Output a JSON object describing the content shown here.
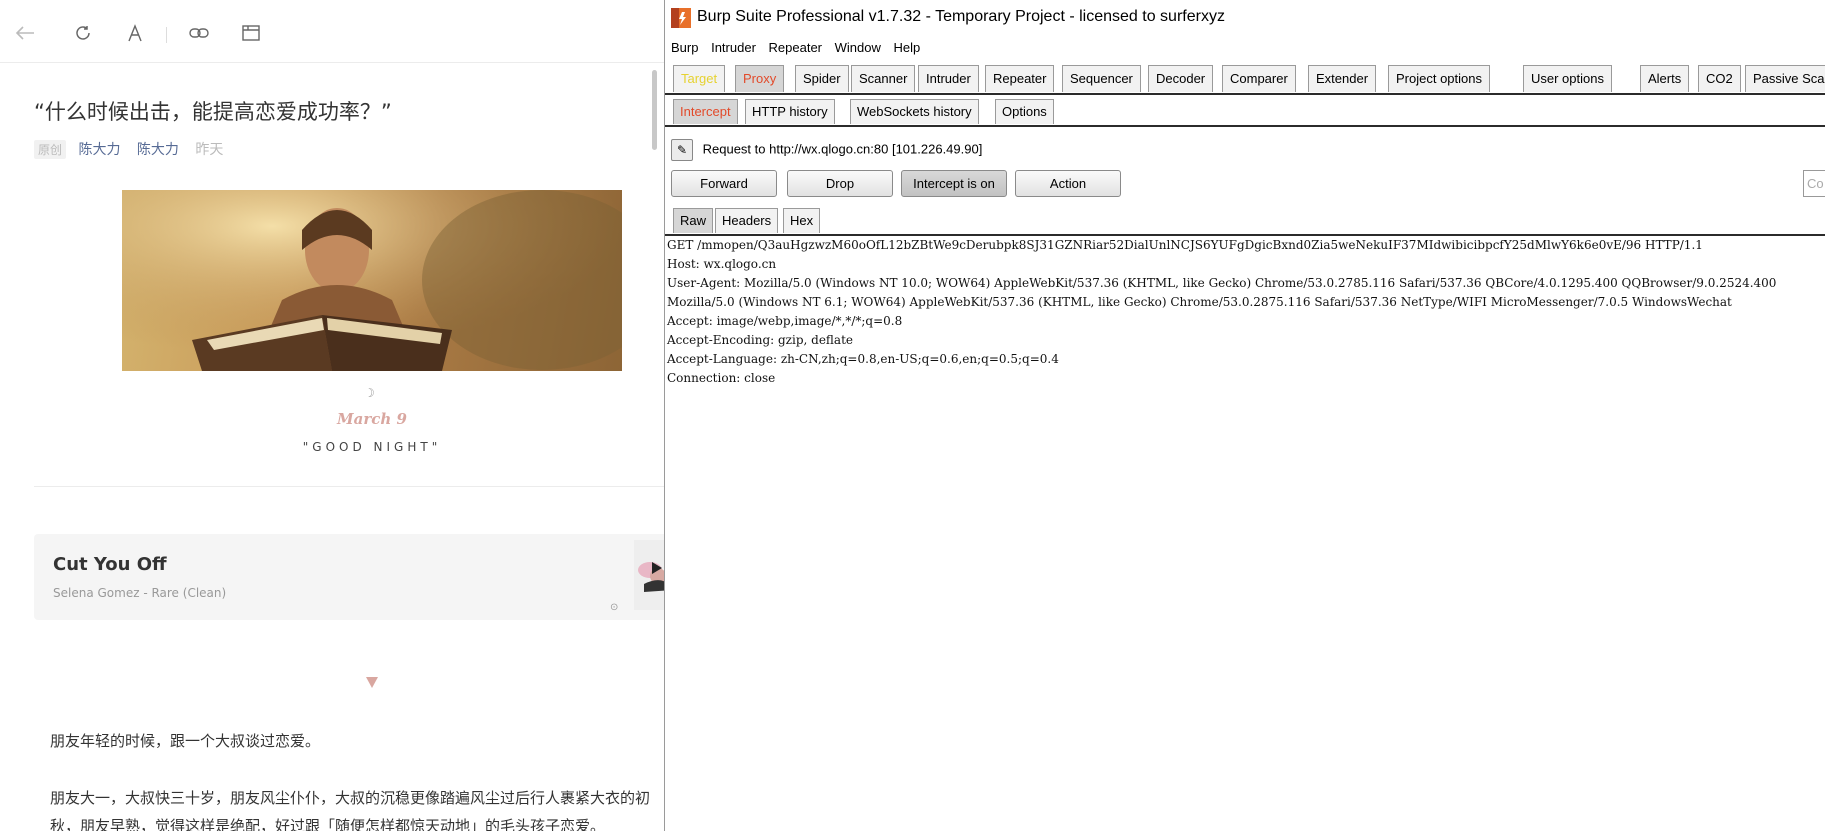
{
  "reader": {
    "toolbar_icons": [
      "back-arrow-icon",
      "refresh-icon",
      "font-icon",
      "link-icon",
      "window-icon",
      "share-icon",
      "cube-icon"
    ],
    "title": "“什么时候出击，能提高恋爱成功率？”",
    "tag": "原创",
    "author1": "陈大力",
    "author2": "陈大力",
    "date": "昨天",
    "moon": "☽",
    "script_date": "March 9",
    "goodnight": "\"GOOD NIGHT\"",
    "music": {
      "song": "Cut You Off",
      "artist": "Selena Gomez - Rare (Clean)"
    },
    "paragraphs": [
      "朋友年轻的时候，跟一个大叔谈过恋爱。",
      "朋友大一，大叔快三十岁，朋友风尘仆仆，大叔的沉稳更像踏遍风尘过后行人裹紧大衣的初",
      "秋，朋友早熟，觉得这样是绝配，好过跟「随便怎样都惊天动地」的毛头孩子恋爱。"
    ]
  },
  "burp": {
    "title": "Burp Suite Professional v1.7.32 - Temporary Project - licensed to surferxyz",
    "menu": [
      "Burp",
      "Intruder",
      "Repeater",
      "Window",
      "Help"
    ],
    "tabs": [
      "Target",
      "Proxy",
      "Spider",
      "Scanner",
      "Intruder",
      "Repeater",
      "Sequencer",
      "Decoder",
      "Comparer",
      "Extender",
      "Project options",
      "User options",
      "Alerts",
      "CO2",
      "Passive Scan Clier"
    ],
    "subtabs": [
      "Intercept",
      "HTTP history",
      "WebSockets history",
      "Options"
    ],
    "request_to": "Request to http://wx.qlogo.cn:80  [101.226.49.90]",
    "buttons": {
      "forward": "Forward",
      "drop": "Drop",
      "intercept": "Intercept is on",
      "action": "Action"
    },
    "comment_placeholder": "Co",
    "view_tabs": [
      "Raw",
      "Headers",
      "Hex"
    ],
    "request_lines": [
      "GET /mmopen/Q3auHgzwzM60oOfL12bZBtWe9cDerubpk8SJ31GZNRiar52DialUnlNCJS6YUFgDgicBxnd0Zia5weNekuIF37MIdwibicibpcfY25dMlwY6k6e0vE/96 HTTP/1.1",
      "Host: wx.qlogo.cn",
      "User-Agent: Mozilla/5.0 (Windows NT 10.0; WOW64) AppleWebKit/537.36 (KHTML, like Gecko) Chrome/53.0.2785.116 Safari/537.36 QBCore/4.0.1295.400 QQBrowser/9.0.2524.400",
      "Mozilla/5.0 (Windows NT 6.1; WOW64) AppleWebKit/537.36 (KHTML, like Gecko) Chrome/53.0.2875.116 Safari/537.36 NetType/WIFI MicroMessenger/7.0.5 WindowsWechat",
      "Accept: image/webp,image/*,*/*;q=0.8",
      "Accept-Encoding: gzip, deflate",
      "Accept-Language: zh-CN,zh;q=0.8,en-US;q=0.6,en;q=0.5;q=0.4",
      "Connection: close"
    ]
  }
}
